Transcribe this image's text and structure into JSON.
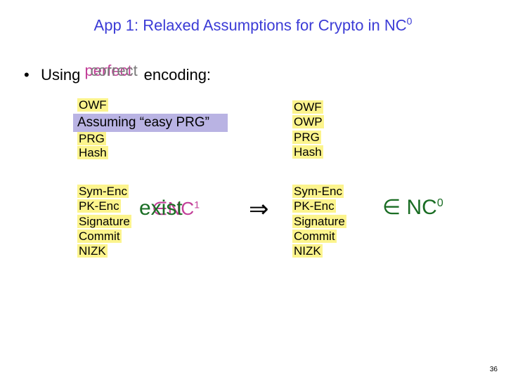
{
  "title_prefix": "App 1: Relaxed Assumptions for Crypto in NC",
  "title_sup": "0",
  "bullet_using": "Using",
  "bullet_word_perfect": "perfect",
  "bullet_word_correct": "correct",
  "bullet_encoding": " encoding:",
  "top_left": {
    "owf": "OWF",
    "assume": "Assuming “easy PRG”",
    "prg": "PRG",
    "hash": "Hash"
  },
  "top_right": {
    "l1": "OWF",
    "l2": "OWP",
    "l3": "PRG",
    "l4": "Hash"
  },
  "bot_left": {
    "l1": "Sym-Enc",
    "l2": "PK-Enc",
    "l3": "Signature",
    "l4": "Commit",
    "l5": "NIZK"
  },
  "exist_nc_text": "∈NC",
  "exist_nc_sup": "1",
  "exist_text": "exist",
  "arrow": "⇒",
  "bot_right": {
    "l1": "Sym-Enc",
    "l2": "PK-Enc",
    "l3": "Signature",
    "l4": "Commit",
    "l5": "NIZK"
  },
  "in_nc_text": "∈ NC",
  "in_nc_sup": "0",
  "pagenum": "36"
}
